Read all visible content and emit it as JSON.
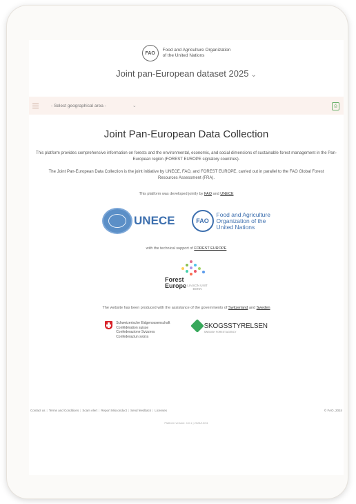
{
  "header": {
    "org_line1": "Food and Agriculture Organization",
    "org_line2": "of the United Nations",
    "dataset_label": "Joint pan-European dataset 2025",
    "fao_logo_letters": "FAO"
  },
  "filter": {
    "geo_select": "- Select geographical area -"
  },
  "main": {
    "title": "Joint Pan-European Data Collection",
    "intro": "This platform provides comprehensive information on forests and the environmental, economic, and social dimensions of sustainable forest management in the Pan-European region (FOREST EUROPE signatory countries).",
    "initiative": "The Joint Pan-European Data Collection is the joint initiative by UNECE, FAO, and FOREST EUROPE, carried out in parallel to the FAO Global Forest Resources Assessment (FRA).",
    "developed_prefix": "This platform was developed jointly by",
    "developed_fao": "FAO",
    "developed_and": "and",
    "developed_unece": "UNECE",
    "unece_logo_text": "UNECE",
    "fao_logo_line1": "Food and Agriculture",
    "fao_logo_line2": "Organization of the",
    "fao_logo_line3": "United Nations",
    "support_prefix": "with the technical support of",
    "support_link": "FOREST EUROPE",
    "fe_word1": "Forest",
    "fe_word2": "Europe",
    "fe_sub": "LIAISON UNIT BONN",
    "produced_prefix": "The website has been produced with the assistance of the governments of",
    "produced_swiss": "Switzerland",
    "produced_and": "and",
    "produced_sweden": "Sweden",
    "swiss_line1": "Schweizerische Eidgenossenschaft",
    "swiss_line2": "Confédération suisse",
    "swiss_line3": "Confederazione Svizzera",
    "swiss_line4": "Confederaziun svizra",
    "sks_name": "SKOGSSTYRELSEN",
    "sks_sub": "SWEDISH FOREST AGENCY"
  },
  "footer": {
    "links": [
      "Contact us",
      "Terms and Conditions",
      "Scam Alert",
      "Report Misconduct",
      "Send feedback",
      "Licenses"
    ],
    "separator": "|",
    "copyright": "© FAO, 2024",
    "version": "Platform version: 4.0.1 | 2024/10/31"
  },
  "colors": {
    "accent_blue": "#3d6fae",
    "filter_bg": "#fbf2ee",
    "swiss_red": "#d8232a",
    "sks_green": "#38a85b"
  }
}
